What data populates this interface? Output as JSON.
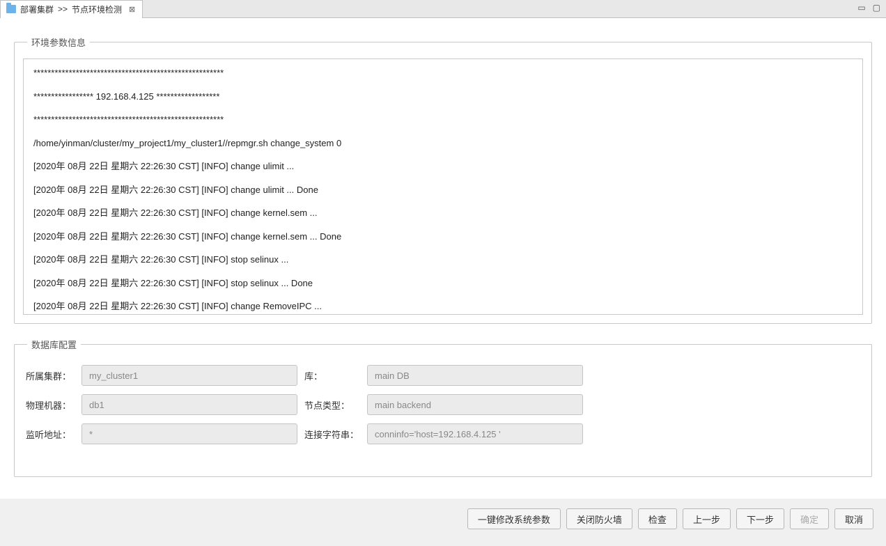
{
  "tab": {
    "breadcrumb_parent": "部署集群",
    "breadcrumb_sep": ">>",
    "title": "节点环境检测",
    "close_glyph": "⊠"
  },
  "window_controls": {
    "minimize": "▭",
    "maximize": "▢"
  },
  "env_panel": {
    "legend": "环境参数信息",
    "log_lines": [
      "******************************************************",
      "***************** 192.168.4.125 ******************",
      "******************************************************",
      "/home/yinman/cluster/my_project1/my_cluster1//repmgr.sh change_system 0",
      "[2020年 08月 22日 星期六 22:26:30 CST] [INFO] change ulimit ...",
      "[2020年 08月 22日 星期六 22:26:30 CST] [INFO] change ulimit ... Done",
      "[2020年 08月 22日 星期六 22:26:30 CST] [INFO] change kernel.sem ...",
      "[2020年 08月 22日 星期六 22:26:30 CST] [INFO] change kernel.sem ... Done",
      "[2020年 08月 22日 星期六 22:26:30 CST] [INFO] stop selinux ...",
      "[2020年 08月 22日 星期六 22:26:30 CST] [INFO] stop selinux ... Done",
      "[2020年 08月 22日 星期六 22:26:30 CST] [INFO] change RemoveIPC ..."
    ]
  },
  "db_panel": {
    "legend": "数据库配置",
    "fields": {
      "cluster_label": "所属集群：",
      "cluster_value": "my_cluster1",
      "db_label": "库：",
      "db_value": "main DB",
      "host_label": "物理机器：",
      "host_value": "db1",
      "nodetype_label": "节点类型：",
      "nodetype_value": "main backend",
      "listen_label": "监听地址：",
      "listen_value": "*",
      "conn_label": "连接字符串：",
      "conn_value": "conninfo='host=192.168.4.125 '"
    }
  },
  "buttons": {
    "modify_params": "一键修改系统参数",
    "close_firewall": "关闭防火墙",
    "check": "检查",
    "prev": "上一步",
    "next": "下一步",
    "ok": "确定",
    "cancel": "取消"
  }
}
